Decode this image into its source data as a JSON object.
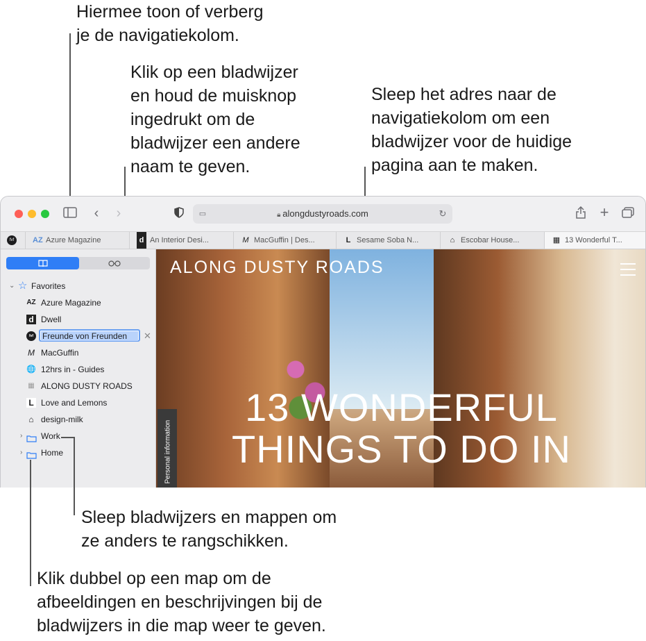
{
  "callouts": {
    "sidebar_toggle": [
      "Hiermee toon of verberg",
      "je de navigatiekolom."
    ],
    "rename_bookmark": [
      "Klik op een bladwijzer",
      "en houd de muisknop",
      "ingedrukt om de",
      "bladwijzer een andere",
      "naam te geven."
    ],
    "drag_address": [
      "Sleep het adres naar de",
      "navigatiekolom om een",
      "bladwijzer voor de huidige",
      "pagina aan te maken."
    ],
    "rearrange": [
      "Sleep bladwijzers en mappen om",
      "ze anders te rangschikken."
    ],
    "double_click_folder": [
      "Klik dubbel op een map om de",
      "afbeeldingen en beschrijvingen bij de",
      "bladwijzers in die map weer te geven."
    ]
  },
  "toolbar": {
    "url": "alongdustyroads.com"
  },
  "tabs": [
    {
      "icon": "AZ",
      "label": "Azure Magazine"
    },
    {
      "icon": "d",
      "label": "An Interior Desi..."
    },
    {
      "icon": "M",
      "label": "MacGuffin | Des..."
    },
    {
      "icon": "L",
      "label": "Sesame Soba N..."
    },
    {
      "icon": "⌂",
      "label": "Escobar House..."
    },
    {
      "icon": "▦",
      "label": "13 Wonderful T..."
    }
  ],
  "sidebar": {
    "favorites_label": "Favorites",
    "items": [
      {
        "icon": "AZ",
        "label": "Azure Magazine"
      },
      {
        "icon": "d",
        "label": "Dwell"
      },
      {
        "icon": "fvf",
        "label": "Freunde von Freunden",
        "editing": true
      },
      {
        "icon": "M",
        "label": "MacGuffin"
      },
      {
        "icon": "🌐",
        "label": "12hrs in - Guides"
      },
      {
        "icon": "▦",
        "label": "ALONG DUSTY ROADS"
      },
      {
        "icon": "L",
        "label": "Love and Lemons"
      },
      {
        "icon": "⌂",
        "label": "design-milk"
      }
    ],
    "folders": [
      {
        "label": "Work"
      },
      {
        "label": "Home"
      }
    ]
  },
  "page": {
    "brand": "ALONG DUSTY ROADS",
    "headline_line1": "13 WONDERFUL",
    "headline_line2": "THINGS TO DO IN",
    "side_tab": "Personal information"
  },
  "colors": {
    "accent": "#2f7ef6",
    "close": "#fe5f57",
    "minimize": "#febc2e",
    "zoom": "#28c840"
  }
}
